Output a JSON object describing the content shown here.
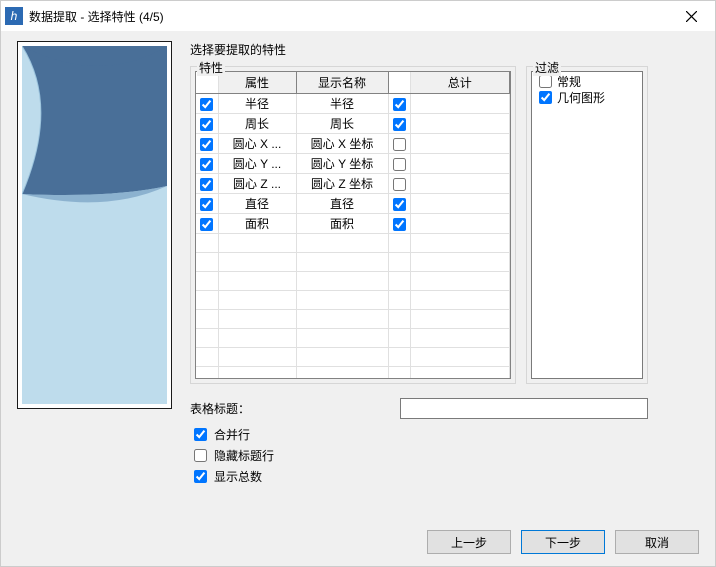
{
  "title": "数据提取 - 选择特性 (4/5)",
  "heading": "选择要提取的特性",
  "sections": {
    "properties": "特性",
    "filter": "过滤"
  },
  "columns": {
    "attr": "属性",
    "display": "显示名称",
    "total": "总计"
  },
  "rows": [
    {
      "attr": "半径",
      "display": "半径",
      "sel": true,
      "tot": true
    },
    {
      "attr": "周长",
      "display": "周长",
      "sel": true,
      "tot": true
    },
    {
      "attr": "圆心 X ...",
      "display": "圆心 X 坐标",
      "sel": true,
      "tot": false
    },
    {
      "attr": "圆心 Y ...",
      "display": "圆心 Y 坐标",
      "sel": true,
      "tot": false
    },
    {
      "attr": "圆心 Z ...",
      "display": "圆心 Z 坐标",
      "sel": true,
      "tot": false
    },
    {
      "attr": "直径",
      "display": "直径",
      "sel": true,
      "tot": true
    },
    {
      "attr": "面积",
      "display": "面积",
      "sel": true,
      "tot": true
    }
  ],
  "filters": [
    {
      "label": "常规",
      "checked": false
    },
    {
      "label": "几何图形",
      "checked": true
    }
  ],
  "form": {
    "table_title_label": "表格标题：",
    "table_title_value": "",
    "options": [
      {
        "label": "合并行",
        "checked": true
      },
      {
        "label": "隐藏标题行",
        "checked": false
      },
      {
        "label": "显示总数",
        "checked": true
      }
    ]
  },
  "buttons": {
    "back": "上一步",
    "next": "下一步",
    "cancel": "取消"
  }
}
